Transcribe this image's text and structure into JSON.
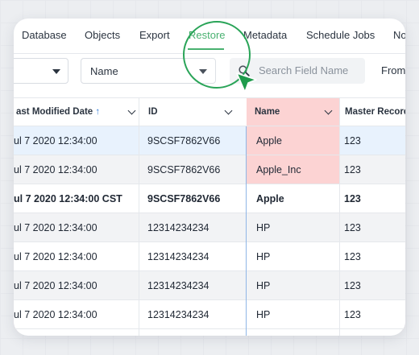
{
  "tabs": [
    {
      "label": "Database"
    },
    {
      "label": "Objects"
    },
    {
      "label": "Export"
    },
    {
      "label": "Restore",
      "active": true
    },
    {
      "label": "Metadata"
    },
    {
      "label": "Schedule Jobs"
    },
    {
      "label": "No"
    }
  ],
  "toolbar": {
    "select_left_value": "",
    "select_field_value": "Name",
    "search_placeholder": "Search Field Name",
    "from_label": "From"
  },
  "table": {
    "headers": [
      {
        "label": "ast Modified Date",
        "sort": "↑"
      },
      {
        "label": "ID"
      },
      {
        "label": "Name"
      },
      {
        "label": "Master Record"
      }
    ],
    "rows": [
      {
        "date": "ul 7 2020 12:34:00",
        "id": "9SCSF7862V66",
        "name": "Apple",
        "master": "123",
        "bg": "#e8f2fd",
        "bold": false,
        "name_highlight": true
      },
      {
        "date": "ul 7 2020 12:34:00",
        "id": "9SCSF7862V66",
        "name": "Apple_Inc",
        "master": "123",
        "bg": "#f2f3f5",
        "bold": false,
        "name_highlight": true
      },
      {
        "date": "ul 7 2020 12:34:00 CST",
        "id": "9SCSF7862V66",
        "name": "Apple",
        "master": "123",
        "bg": "#ffffff",
        "bold": true,
        "name_highlight": false
      },
      {
        "date": "ul 7 2020 12:34:00",
        "id": "12314234234",
        "name": "HP",
        "master": "123",
        "bg": "#f2f3f5",
        "bold": false,
        "name_highlight": false
      },
      {
        "date": "ul 7 2020 12:34:00",
        "id": "12314234234",
        "name": "HP",
        "master": "123",
        "bg": "#ffffff",
        "bold": false,
        "name_highlight": false
      },
      {
        "date": "ul 7 2020 12:34:00",
        "id": "12314234234",
        "name": "HP",
        "master": "123",
        "bg": "#f2f3f5",
        "bold": false,
        "name_highlight": false
      },
      {
        "date": "ul 7 2020 12:34:00",
        "id": "12314234234",
        "name": "HP",
        "master": "123",
        "bg": "#ffffff",
        "bold": false,
        "name_highlight": false
      }
    ]
  },
  "colors": {
    "accent": "#2aa458",
    "name_highlight": "#fcd3d3",
    "selected_row": "#e8f2fd",
    "sort_arrow": "#2f7bd8"
  },
  "icons": {
    "search": "search-icon",
    "cursor": "pointer-cursor-icon"
  }
}
